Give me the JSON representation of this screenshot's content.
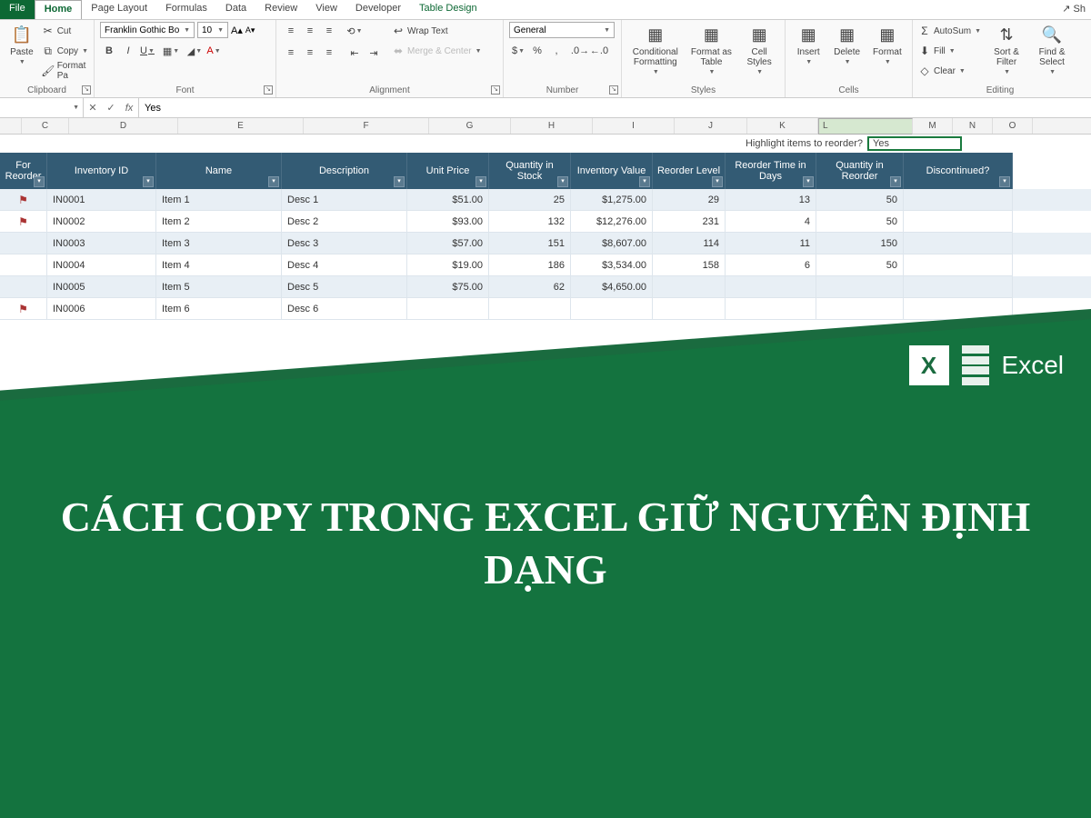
{
  "tabs": {
    "file": "File",
    "home": "Home",
    "others": [
      "Page Layout",
      "Formulas",
      "Data",
      "Review",
      "View",
      "Developer"
    ],
    "context": "Table Design",
    "share": "Sh"
  },
  "ribbon": {
    "clipboard": {
      "label": "Clipboard",
      "paste": "Paste",
      "cut": "Cut",
      "copy": "Copy",
      "fmt": "Format Pa"
    },
    "font": {
      "label": "Font",
      "family": "Franklin Gothic Book",
      "size": "10",
      "bold": "B",
      "italic": "I",
      "underline": "U"
    },
    "alignment": {
      "label": "Alignment",
      "wrap": "Wrap Text",
      "merge": "Merge & Center"
    },
    "number": {
      "label": "Number",
      "format": "General"
    },
    "styles": {
      "label": "Styles",
      "cf": "Conditional Formatting",
      "fat": "Format as Table",
      "cs": "Cell Styles"
    },
    "cells": {
      "label": "Cells",
      "insert": "Insert",
      "delete": "Delete",
      "format": "Format"
    },
    "editing": {
      "label": "Editing",
      "autosum": "AutoSum",
      "fill": "Fill",
      "clear": "Clear",
      "sort": "Sort & Filter",
      "find": "Find & Select"
    }
  },
  "formula_bar": {
    "name": "",
    "value": "Yes",
    "fx": "fx"
  },
  "columns": [
    "C",
    "D",
    "E",
    "F",
    "G",
    "H",
    "I",
    "J",
    "K",
    "L",
    "M",
    "N",
    "O"
  ],
  "highlight": {
    "label": "Highlight items to reorder?",
    "value": "Yes"
  },
  "table": {
    "headers": [
      "For Reorder",
      "Inventory ID",
      "Name",
      "Description",
      "Unit Price",
      "Quantity in Stock",
      "Inventory Value",
      "Reorder Level",
      "Reorder Time in Days",
      "Quantity in Reorder",
      "Discontinued?"
    ],
    "rows": [
      {
        "flag": true,
        "id": "IN0001",
        "name": "Item 1",
        "desc": "Desc 1",
        "price": "$51.00",
        "qty": "25",
        "val": "$1,275.00",
        "rl": "29",
        "rt": "13",
        "qr": "50",
        "disc": ""
      },
      {
        "flag": true,
        "id": "IN0002",
        "name": "Item 2",
        "desc": "Desc 2",
        "price": "$93.00",
        "qty": "132",
        "val": "$12,276.00",
        "rl": "231",
        "rt": "4",
        "qr": "50",
        "disc": ""
      },
      {
        "flag": false,
        "id": "IN0003",
        "name": "Item 3",
        "desc": "Desc 3",
        "price": "$57.00",
        "qty": "151",
        "val": "$8,607.00",
        "rl": "114",
        "rt": "11",
        "qr": "150",
        "disc": ""
      },
      {
        "flag": false,
        "id": "IN0004",
        "name": "Item 4",
        "desc": "Desc 4",
        "price": "$19.00",
        "qty": "186",
        "val": "$3,534.00",
        "rl": "158",
        "rt": "6",
        "qr": "50",
        "disc": ""
      },
      {
        "flag": false,
        "id": "IN0005",
        "name": "Item 5",
        "desc": "Desc 5",
        "price": "$75.00",
        "qty": "62",
        "val": "$4,650.00",
        "rl": "",
        "rt": "",
        "qr": "",
        "disc": ""
      },
      {
        "flag": true,
        "id": "IN0006",
        "name": "Item 6",
        "desc": "Desc 6",
        "price": "",
        "qty": "",
        "val": "",
        "rl": "",
        "rt": "",
        "qr": "",
        "disc": ""
      }
    ]
  },
  "overlay": {
    "title": "CÁCH COPY TRONG EXCEL GIỮ NGUYÊN ĐỊNH DẠNG",
    "product": "Excel"
  }
}
